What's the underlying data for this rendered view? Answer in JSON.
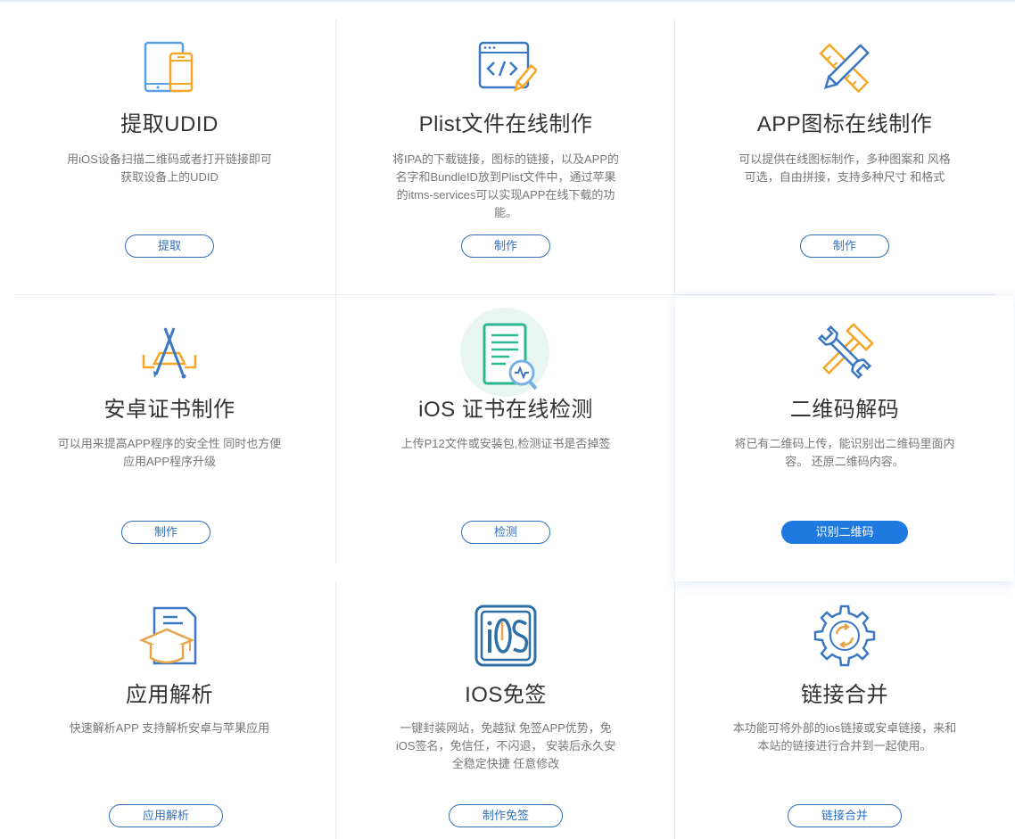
{
  "cards": [
    {
      "title": "提取UDID",
      "desc": [
        "用iOS设备扫描二维码或者打开链接即可",
        "获取设备上的UDID"
      ],
      "button": "提取",
      "icon": "devices-icon"
    },
    {
      "title": "Plist文件在线制作",
      "desc": [
        "将IPA的下载链接，图标的链接，以及APP的",
        "名字和BundleID放到Plist文件中，通过苹果",
        "的itms-services可以实现APP在线下载的功",
        "能。"
      ],
      "button": "制作",
      "icon": "code-window-pencil-icon"
    },
    {
      "title": "APP图标在线制作",
      "desc": [
        "可以提供在线图标制作，多种图案和 风格",
        "可选，自由拼接，支持多种尺寸 和格式"
      ],
      "button": "制作",
      "icon": "ruler-pencil-icon"
    },
    {
      "title": "安卓证书制作",
      "desc": [
        "可以用来提高APP程序的安全性 同时也方便",
        "应用APP程序升级"
      ],
      "button": "制作",
      "icon": "app-store-tools-icon"
    },
    {
      "title": "iOS 证书在线检测",
      "desc": [
        "上传P12文件或安装包,检测证书是否掉签"
      ],
      "button": "检测",
      "icon": "document-search-icon"
    },
    {
      "title": "二维码解码",
      "desc": [
        "将已有二维码上传，能识别出二维码里面内",
        "容。 还原二维码内容。"
      ],
      "button": "识别二维码",
      "icon": "wrench-hammer-icon"
    },
    {
      "title": "应用解析",
      "desc": [
        "快速解析APP 支持解析安卓与苹果应用"
      ],
      "button": "应用解析",
      "icon": "graduation-document-icon"
    },
    {
      "title": "IOS免签",
      "desc": [
        "一键封装网站，免越狱 免签APP优势，免",
        "iOS签名，免信任，不闪退， 安装后永久安",
        "全稳定快捷 任意修改"
      ],
      "button": "制作免签",
      "icon": "ios-badge-icon"
    },
    {
      "title": "链接合并",
      "desc": [
        "本功能可将外部的ios链接或安卓链接，来和",
        "本站的链接进行合并到一起使用。"
      ],
      "button": "链接合并",
      "icon": "gear-sync-icon"
    }
  ],
  "colors": {
    "accent": "#1f7ae0",
    "button_border": "#2f6fbc",
    "icon_blue": "#3a78c4",
    "icon_orange": "#f5a623",
    "icon_green": "#2bb78f"
  }
}
